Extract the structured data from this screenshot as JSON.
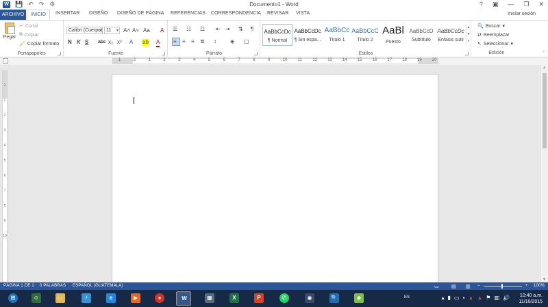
{
  "window": {
    "title": "Documento1 - Word",
    "help": "?",
    "controls": [
      "▣",
      "—",
      "❐",
      "✕"
    ]
  },
  "quick_access": [
    "💾",
    "↶",
    "↷",
    "⚙"
  ],
  "tabs": {
    "file": "ARCHIVO",
    "items": [
      {
        "label": "INICIO",
        "active": true
      },
      {
        "label": "INSERTAR"
      },
      {
        "label": "DISEÑO"
      },
      {
        "label": "DISEÑO DE PÁGINA"
      },
      {
        "label": "REFERENCIAS"
      },
      {
        "label": "CORRESPONDENCIA"
      },
      {
        "label": "REVISAR"
      },
      {
        "label": "VISTA"
      }
    ],
    "signin": "Iniciar sesión"
  },
  "ribbon": {
    "clipboard": {
      "paste": "Pegar",
      "cut": "Cortar",
      "copy": "Copiar",
      "format_painter": "Copiar formato",
      "label": "Portapapeles"
    },
    "font": {
      "name": "Calibri (Cuerpo)",
      "size": "11",
      "grow": "A˄",
      "shrink": "A˅",
      "case": "Aa",
      "clear": "A",
      "bold": "N",
      "italic": "K",
      "underline": "S",
      "strike": "abc",
      "subscript": "x₂",
      "superscript": "x²",
      "effects": "A",
      "highlight": "ab",
      "color": "A",
      "label": "Fuente"
    },
    "paragraph": {
      "label": "Párrafo",
      "pilcrow": "¶"
    },
    "styles": {
      "label": "Estilos",
      "items": [
        {
          "sample": "AaBbCcDc",
          "name": "¶ Normal"
        },
        {
          "sample": "AaBbCcDc",
          "name": "¶ Sin espa..."
        },
        {
          "sample": "AaBbCc",
          "name": "Título 1"
        },
        {
          "sample": "AaBbCcC",
          "name": "Título 2"
        },
        {
          "sample": "AaBl",
          "name": "Puesto"
        },
        {
          "sample": "AaBbCcD",
          "name": "Subtítulo"
        },
        {
          "sample": "AaBbCcDc",
          "name": "Énfasis sutil"
        }
      ]
    },
    "editing": {
      "find": "Buscar",
      "replace": "Reemplazar",
      "select": "Seleccionar",
      "label": "Edición"
    }
  },
  "ruler": {
    "h_numbers": [
      "1",
      "2",
      "1",
      "2",
      "3",
      "4",
      "5",
      "6",
      "7",
      "8",
      "9",
      "10",
      "11",
      "12",
      "13",
      "14",
      "15",
      "16",
      "17",
      "18",
      "19",
      "20"
    ],
    "v_numbers": [
      "1",
      "1",
      "2",
      "3",
      "4",
      "5",
      "6",
      "7",
      "8",
      "9",
      "10"
    ]
  },
  "statusbar": {
    "page": "PÁGINA 1 DE 1",
    "words": "0 PALABRAS",
    "language": "ESPAÑOL (GUATEMALA)",
    "zoom": "100%"
  },
  "taskbar": {
    "apps": [
      {
        "name": "start",
        "color": "#1e73be",
        "glyph": "⊞"
      },
      {
        "name": "people",
        "color": "#2f6e3a",
        "glyph": "☺"
      },
      {
        "name": "explorer",
        "color": "#e4b84a",
        "glyph": "▭"
      },
      {
        "name": "network",
        "color": "#3a8fd9",
        "glyph": "⚡"
      },
      {
        "name": "ie",
        "color": "#1e88e5",
        "glyph": "e"
      },
      {
        "name": "media",
        "color": "#e86a1a",
        "glyph": "▶"
      },
      {
        "name": "chrome",
        "color": "#d93025",
        "glyph": "●"
      },
      {
        "name": "word",
        "color": "#2b579a",
        "glyph": "W",
        "active": true
      },
      {
        "name": "calc",
        "color": "#5a6b7c",
        "glyph": "▦"
      },
      {
        "name": "excel",
        "color": "#1e7145",
        "glyph": "X"
      },
      {
        "name": "powerpoint",
        "color": "#d04423",
        "glyph": "P"
      },
      {
        "name": "whatsapp",
        "color": "#25d366",
        "glyph": "✆"
      },
      {
        "name": "webcam",
        "color": "#3b4a66",
        "glyph": "◉"
      },
      {
        "name": "search",
        "color": "#1a6fb8",
        "glyph": "🔍"
      },
      {
        "name": "bluestacks",
        "color": "#7bc043",
        "glyph": "◆"
      }
    ],
    "lang": "ES",
    "time": "10:40 a.m.",
    "date": "11/10/2015"
  }
}
